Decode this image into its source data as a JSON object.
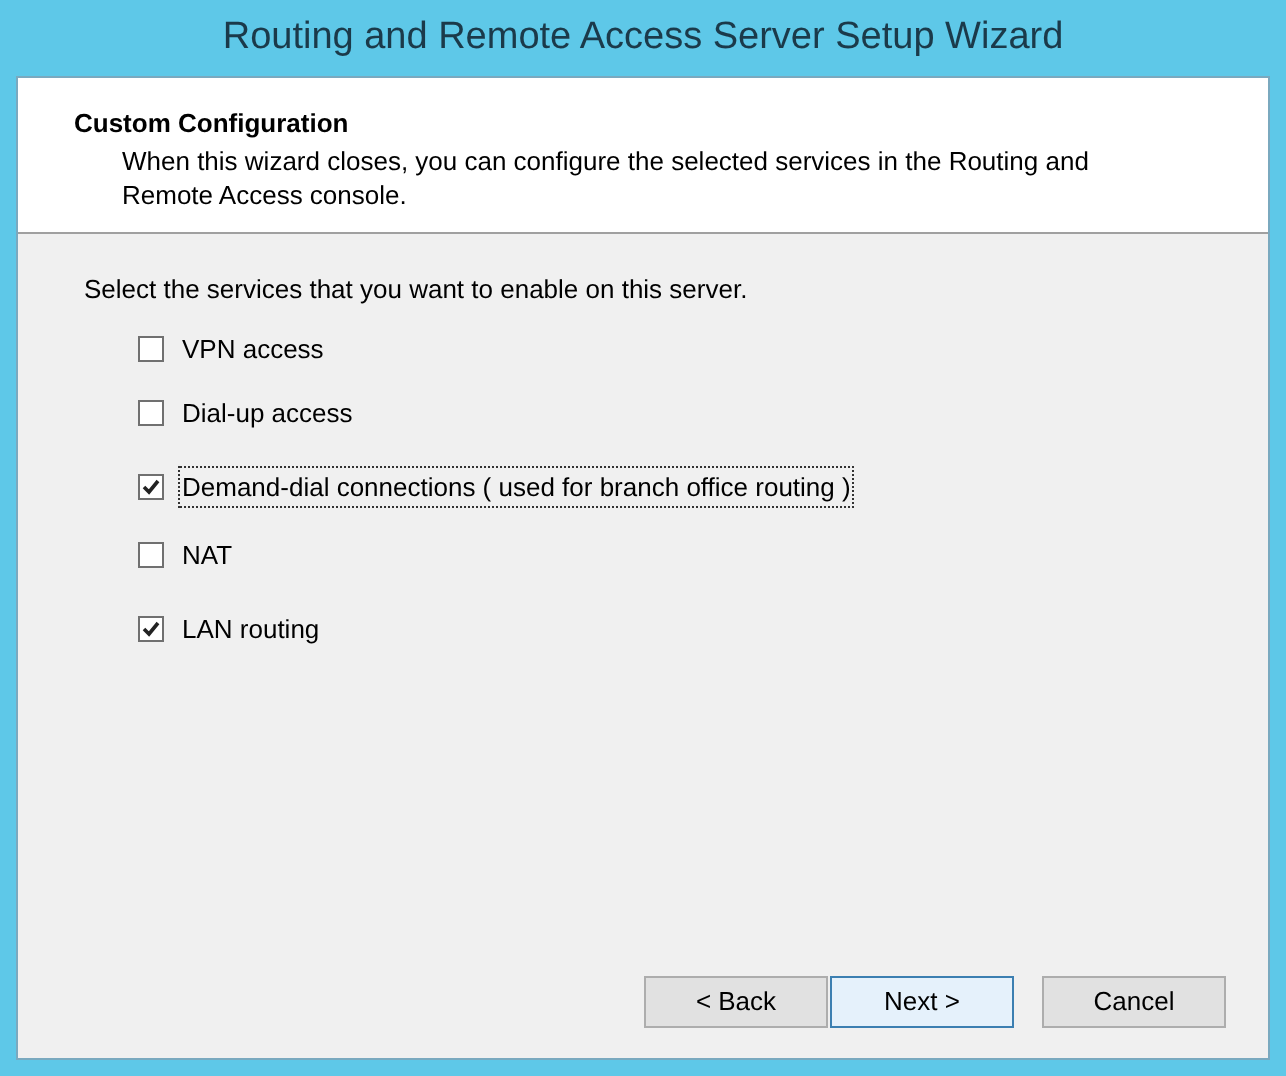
{
  "window": {
    "title": "Routing and Remote Access Server Setup Wizard"
  },
  "header": {
    "title": "Custom Configuration",
    "description": "When this wizard closes, you can configure the selected services in the Routing and Remote Access console."
  },
  "prompt": "Select the services that you want to enable on this server.",
  "services": [
    {
      "label": "VPN access",
      "checked": false,
      "focused": false
    },
    {
      "label": "Dial-up access",
      "checked": false,
      "focused": false
    },
    {
      "label": "Demand-dial connections ( used for branch office routing )",
      "checked": true,
      "focused": true
    },
    {
      "label": "NAT",
      "checked": false,
      "focused": false
    },
    {
      "label": "LAN routing",
      "checked": true,
      "focused": false
    }
  ],
  "buttons": [
    {
      "label": "< Back",
      "default": false
    },
    {
      "label": "Next >",
      "default": true
    },
    {
      "label": "Cancel",
      "default": false
    }
  ]
}
